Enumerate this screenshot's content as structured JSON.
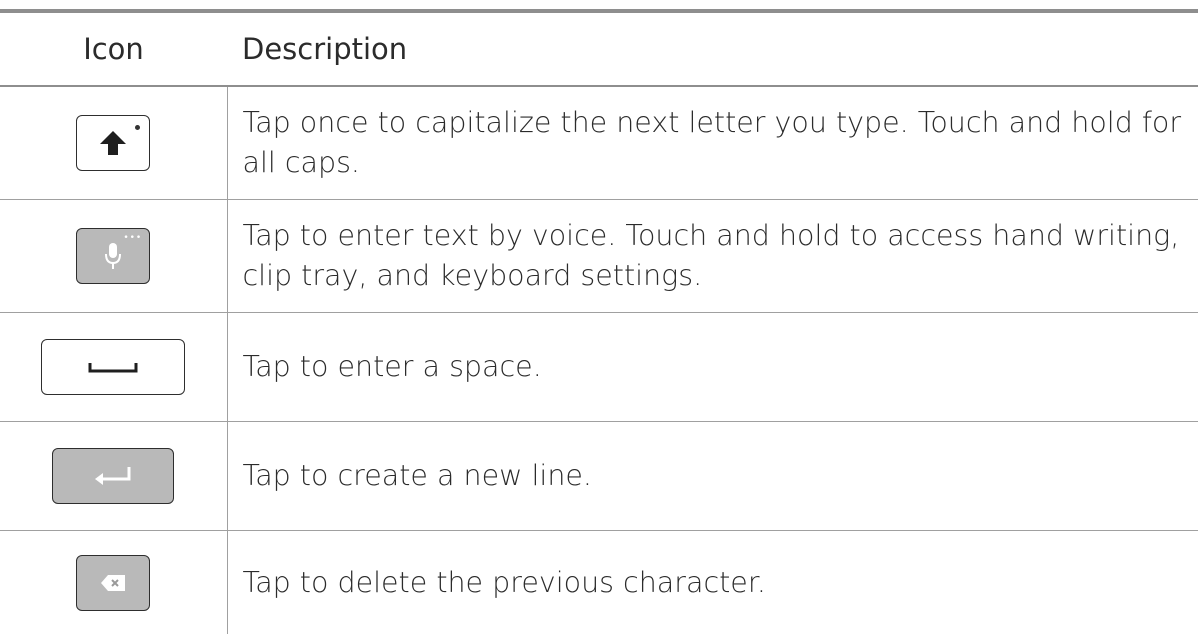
{
  "table": {
    "headers": {
      "icon": "Icon",
      "description": "Description"
    },
    "rows": [
      {
        "icon": "shift-key-icon",
        "description": "Tap once to capitalize the next letter you type. Touch and hold for all caps."
      },
      {
        "icon": "microphone-key-icon",
        "description": "Tap to enter text by voice. Touch and hold to access hand writing, clip tray, and keyboard settings."
      },
      {
        "icon": "space-key-icon",
        "description": "Tap to enter a space."
      },
      {
        "icon": "enter-key-icon",
        "description": "Tap to create a new line."
      },
      {
        "icon": "delete-key-icon",
        "description": "Tap to delete the previous character."
      }
    ]
  },
  "colors": {
    "rule": "#8e8e8e",
    "key_gray": "#b9b9b9",
    "text": "#2b2b2b"
  }
}
